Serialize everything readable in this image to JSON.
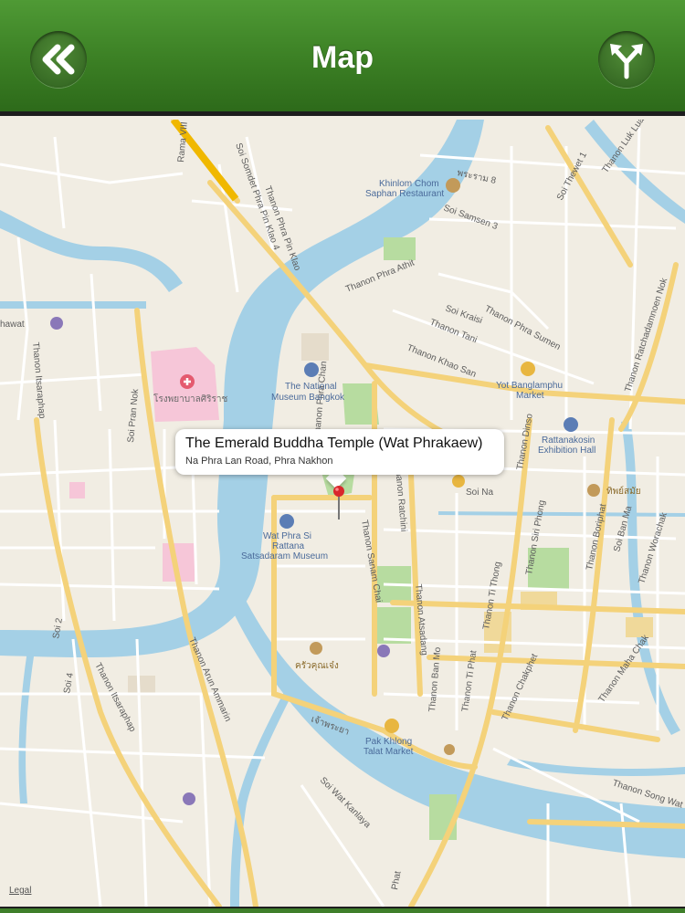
{
  "header": {
    "title": "Map",
    "back_icon": "double-chevron-left-icon",
    "directions_icon": "directions-fork-icon",
    "bar_color": "#3b7f24"
  },
  "callout": {
    "title": "The Emerald Buddha Temple (Wat Phrakaew)",
    "address": "Na Phra Lan Road, Phra Nakhon"
  },
  "map": {
    "legal": "Legal",
    "water_color": "#a4d0e6",
    "park_color": "#b7dca0",
    "road_color": "#ffffff",
    "major_road_color": "#f4d27a",
    "pois": {
      "khinlom": "Khinlom Chom",
      "khinlom2": "Saphan Restaurant",
      "national_museum": "The National",
      "national_museum2": "Museum Bangkok",
      "yot": "Yot Banglamphu",
      "yot2": "Market",
      "rattanakosin": "Rattanakosin",
      "rattanakosin2": "Exhibition Hall",
      "wat_phra": "Wat Phra Si",
      "wat_phra2": "Rattana",
      "wat_phra3": "Satsadaram Museum",
      "pak_khlong": "Pak Khlong",
      "pak_khlong2": "Talat Market",
      "hospital": "โรงพยาบาลศิริราช",
      "thai_rest": "ทิพย์สมัย",
      "thai_market": "ครัวคุณเจ๋ง",
      "river": "เจ้าพระยา"
    },
    "streets": {
      "phra_athit": "Thanon Phra Athit",
      "tani": "Thanon Tani",
      "khao_san": "Thanon Khao San",
      "phra_sumen": "Thanon Phra Sumen",
      "samsen": "Soi Samsen 3",
      "kraisi": "Soi Kraisi",
      "ratchadamnoen": "Thanon Ratchadamnoen Nok",
      "sanam_chai": "Thanon Sanam Chai",
      "atsadang": "Thanon Atsadang",
      "ban_mo": "Thanon Ban Mo",
      "ti_thong": "Thanon Ti Thong",
      "ti_phat": "Thanon Ti Phat",
      "chakphet": "Thanon Chakphet",
      "dinso": "Thanon Dinso",
      "siri_phong": "Thanon Siri Phong",
      "boriphat": "Thanon Boriphat",
      "worachak": "Thanon Worachak",
      "itsaraphap": "Thanon Itsaraphap",
      "itsaraphap2": "Thanon Itsaraphap",
      "arun_ammarin": "Thanon Arun Ammarin",
      "song_wat": "Thanon Song Wat",
      "maha_chak": "Thanon Maha Chak",
      "wat_kanlaya": "Soi Wat Kanlaya",
      "somdet": "Soi Somdet Phra Pin Klao 4",
      "pran_nok": "Soi Pran Nok",
      "sai2": "Soi 2",
      "sai4": "Soi 4",
      "ratchini": "Thanon Ratchini",
      "phra_chan": "Thanon Phra Chan",
      "rama8": "Rama VIII",
      "phrasumen8": "พระราม 8",
      "soi_na": "Soi Na",
      "lukluang": "Thanon Luk Luang",
      "prajak": "Soi Thewet 1",
      "phat": "Phat",
      "hawat": "hawat",
      "somdet_rd": "Soi Ban Ma",
      "wat_thong": "Thanon Phra Pin Klao"
    }
  }
}
